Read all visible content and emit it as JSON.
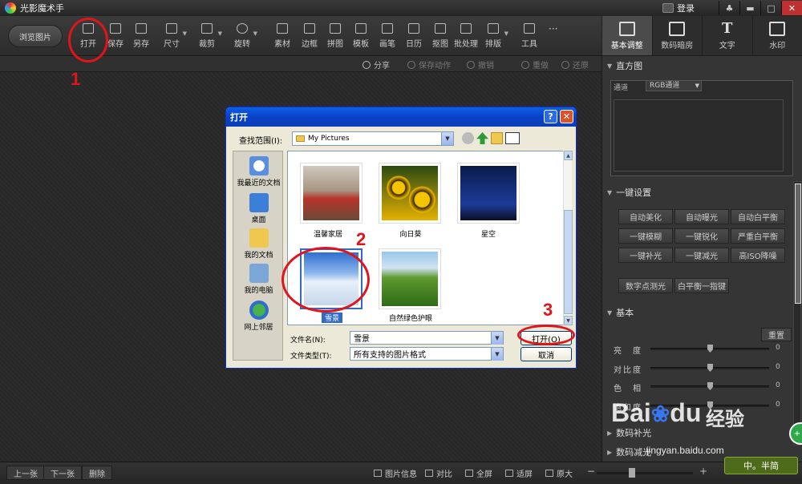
{
  "app": {
    "title": "光影魔术手",
    "login": "登录",
    "window_controls": [
      "♣",
      "▬",
      "□",
      "✕"
    ]
  },
  "toolbar": {
    "browse": "浏览图片",
    "tools": [
      {
        "label": "打开",
        "icon": "open-icon"
      },
      {
        "label": "保存",
        "icon": "save-icon"
      },
      {
        "label": "另存",
        "icon": "save-as-icon"
      },
      {
        "label": "尺寸",
        "icon": "size-icon"
      },
      {
        "label": "裁剪",
        "icon": "crop-icon"
      },
      {
        "label": "旋转",
        "icon": "rotate-icon"
      },
      {
        "label": "素材",
        "icon": "material-icon"
      },
      {
        "label": "边框",
        "icon": "border-icon"
      },
      {
        "label": "拼图",
        "icon": "collage-icon"
      },
      {
        "label": "模板",
        "icon": "template-icon"
      },
      {
        "label": "画笔",
        "icon": "brush-icon"
      },
      {
        "label": "日历",
        "icon": "calendar-icon"
      },
      {
        "label": "抠图",
        "icon": "cutout-icon"
      },
      {
        "label": "批处理",
        "icon": "batch-icon"
      },
      {
        "label": "排版",
        "icon": "layout-icon"
      },
      {
        "label": "工具",
        "icon": "tools-icon"
      },
      {
        "label": "···",
        "icon": "more-icon"
      }
    ]
  },
  "right_tabs": [
    {
      "label": "基本调整",
      "active": true
    },
    {
      "label": "数码暗房",
      "active": false
    },
    {
      "label": "文字",
      "active": false
    },
    {
      "label": "水印",
      "active": false
    }
  ],
  "subbar": {
    "share": "分享",
    "save_action": "保存动作",
    "undo": "撤销",
    "redo": "重做",
    "restore": "还原"
  },
  "panel": {
    "histogram": {
      "title": "直方图",
      "channel_label": "通道",
      "channel_value": "RGB通道"
    },
    "one_click": {
      "title": "一键设置",
      "buttons": [
        "自动美化",
        "自动曝光",
        "自动白平衡",
        "一键模糊",
        "一键锐化",
        "严重白平衡",
        "一键补光",
        "一键减光",
        "高ISO降噪"
      ],
      "extra_buttons": [
        "数字点测光",
        "白平衡一指键"
      ]
    },
    "basic": {
      "title": "基本",
      "reset": "重置",
      "sliders": [
        {
          "label": "亮　度",
          "value": "0"
        },
        {
          "label": "对比度",
          "value": "0"
        },
        {
          "label": "色　相",
          "value": "0"
        },
        {
          "label": "饱和度",
          "value": "0"
        }
      ]
    },
    "collapsed_sections": [
      "数码补光",
      "数码减光"
    ]
  },
  "bottombar": {
    "prev": "上一张",
    "next": "下一张",
    "delete": "删除",
    "items": [
      "图片信息",
      "对比",
      "全屏",
      "适屏",
      "原大"
    ],
    "zoom_minus": "−",
    "zoom_plus": "+"
  },
  "dialog": {
    "title": "打开",
    "help": "?",
    "close": "✕",
    "look_in_label": "查找范围(I):",
    "look_in_value": "My Pictures",
    "places": [
      "我最近的文档",
      "桌面",
      "我的文档",
      "我的电脑",
      "网上邻居"
    ],
    "files": [
      {
        "name": "温馨家居",
        "selected": false
      },
      {
        "name": "向日葵",
        "selected": false
      },
      {
        "name": "星空",
        "selected": false
      },
      {
        "name": "雪景",
        "selected": true
      },
      {
        "name": "自然绿色护眼",
        "selected": false
      }
    ],
    "filename_label": "文件名(N):",
    "filename_value": "雪景",
    "filetype_label": "文件类型(T):",
    "filetype_value": "所有支持的图片格式",
    "open_button": "打开(O)",
    "cancel_button": "取消"
  },
  "annotations": [
    "1",
    "2",
    "3"
  ],
  "watermark": {
    "logo": "Bai",
    "logo_tail": "du",
    "cn": "经验",
    "url": "jingyan.baidu.com",
    "badge": "中。半简"
  },
  "colors": {
    "annotation_red": "#e0141b",
    "xp_title_blue": "#0a5fe8",
    "selection_blue": "#316ac5"
  }
}
